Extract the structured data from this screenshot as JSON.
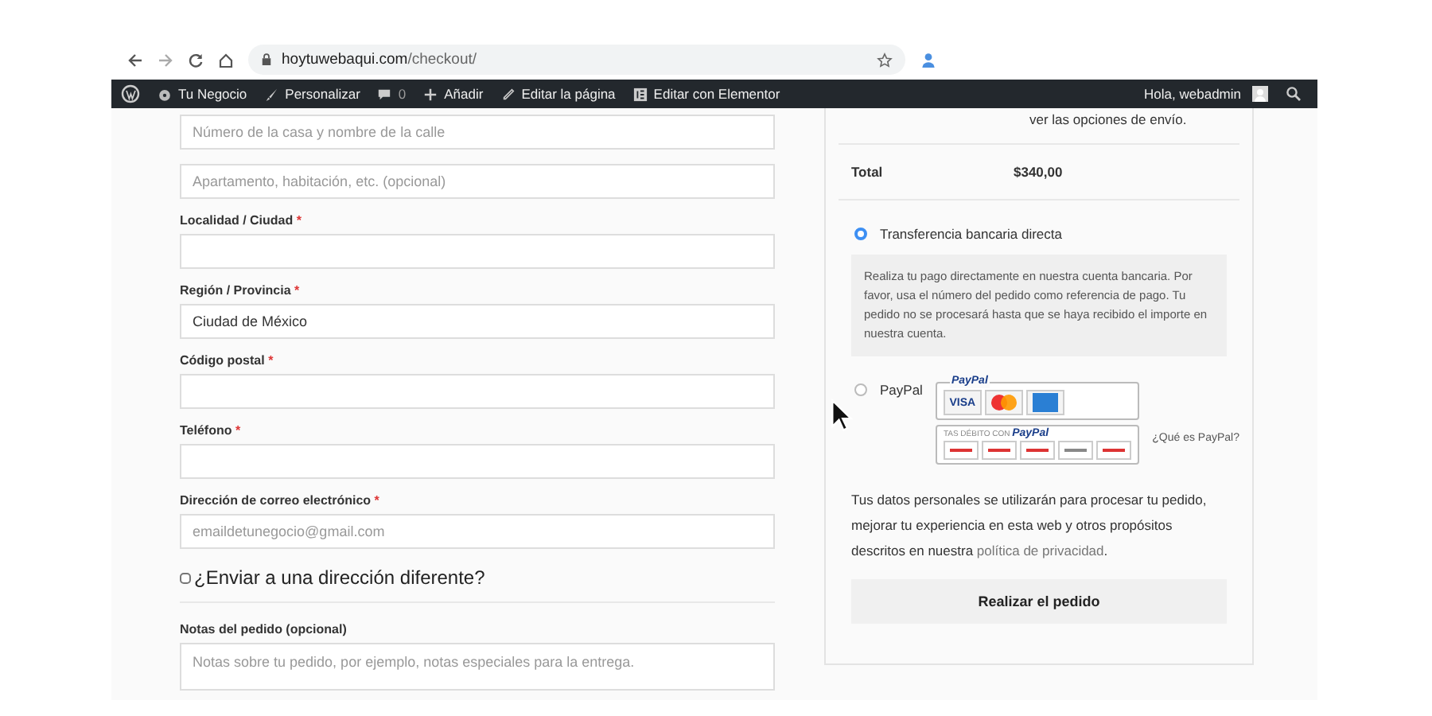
{
  "browser": {
    "url_host": "hoytuwebaqui.com",
    "url_path": "/checkout/"
  },
  "admin_bar": {
    "items": [
      {
        "kind": "site",
        "label": "Tu Negocio"
      },
      {
        "kind": "customize",
        "label": "Personalizar"
      },
      {
        "kind": "comments",
        "label": "0"
      },
      {
        "kind": "new",
        "label": "Añadir"
      },
      {
        "kind": "edit",
        "label": "Editar la página"
      },
      {
        "kind": "elementor",
        "label": "Editar con Elementor"
      }
    ],
    "greeting": "Hola, webadmin"
  },
  "billing_fields": [
    {
      "placeholder": "Número de la casa y nombre de la calle"
    },
    {
      "placeholder": "Apartamento, habitación, etc. (opcional)"
    },
    {
      "label": "Localidad / Ciudad",
      "required_mark": "*"
    },
    {
      "label": "Región / Provincia",
      "required_mark": "*",
      "value": "Ciudad de México"
    },
    {
      "label": "Código postal",
      "required_mark": "*"
    },
    {
      "label": "Teléfono",
      "required_mark": "*"
    },
    {
      "label": "Dirección de correo electrónico",
      "required_mark": "*",
      "placeholder": "emaildetunegocio@gmail.com"
    }
  ],
  "ship_different": {
    "label": "¿Enviar a una dirección diferente?",
    "checked": false
  },
  "notes": {
    "label": "Notas del pedido (opcional)",
    "placeholder": "Notas sobre tu pedido, por ejemplo, notas especiales para la entrega."
  },
  "order": {
    "shipping_note": "ver las opciones de envío.",
    "total_label": "Total",
    "total_value": "$340,00"
  },
  "payment_methods": [
    {
      "kind": "bank",
      "label": "Transferencia bancaria directa",
      "selected": true,
      "description": "Realiza tu pago directamente en nuestra cuenta bancaria. Por favor, usa el número del pedido como referencia de pago. Tu pedido no se procesará hasta que se haya recibido el importe en nuestra cuenta."
    },
    {
      "kind": "paypal",
      "label": "PayPal",
      "selected": false,
      "logo_brand": "PayPal",
      "card_label": "VISA",
      "debit_caption": "TAS DÉBITO CON",
      "debit_brand": "PayPal",
      "link": "¿Qué es PayPal?"
    }
  ],
  "privacy": {
    "text": "Tus datos personales se utilizarán para procesar tu pedido, mejorar tu experiencia en esta web y otros propósitos descritos en nuestra ",
    "link": "política de privacidad",
    "after": "."
  },
  "place_order": "Realizar el pedido"
}
